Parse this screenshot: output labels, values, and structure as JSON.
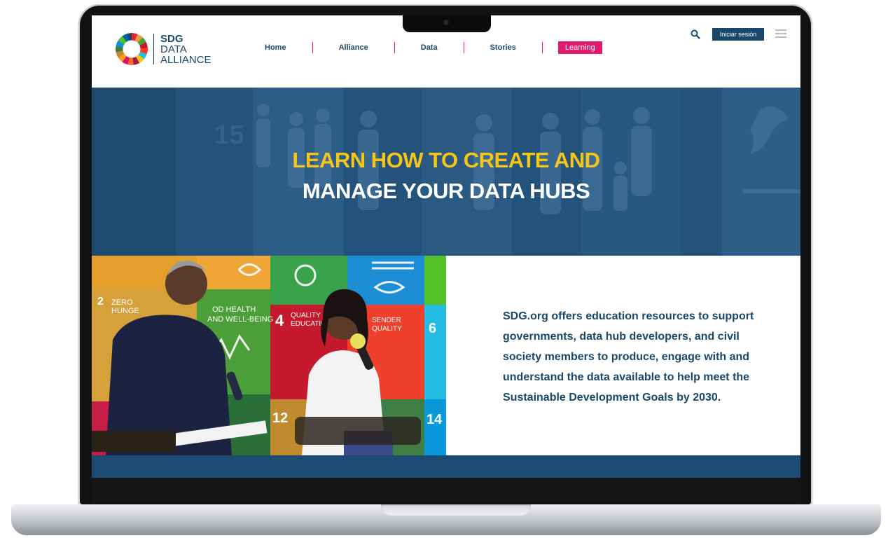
{
  "logo": {
    "line1": "SDG",
    "line2": "DATA",
    "line3": "ALLIANCE"
  },
  "nav": {
    "items": [
      {
        "label": "Home"
      },
      {
        "label": "Alliance"
      },
      {
        "label": "Data"
      },
      {
        "label": "Stories"
      },
      {
        "label": "Learning",
        "active": true
      }
    ]
  },
  "header": {
    "login_label": "Iniciar sesión",
    "search_icon": "search-icon",
    "menu_icon": "hamburger-menu-icon"
  },
  "hero": {
    "title_line1": "LEARN HOW TO CREATE AND",
    "title_line2": "MANAGE YOUR DATA HUBS"
  },
  "photo_tiles": {
    "zero": "ZERO",
    "hunger": "HUNGE",
    "good_health": "OD HEALTH",
    "well_being": "AND WELL-BEING",
    "quality": "QUALITY",
    "education": "EDUCATIO",
    "gender": "SENDER",
    "equality": "QUALITY",
    "n2": "2",
    "n4": "4",
    "n6": "6",
    "n12": "12",
    "n14": "14"
  },
  "intro": {
    "text": "SDG.org offers education resources to support governments, data hub developers, and civil society members to produce, engage with and understand the data available to help meet the Sustainable Development Goals by 2030."
  },
  "colors": {
    "navy": "#19486a",
    "hero_blue": "#23527a",
    "yellow": "#f5c518",
    "pink": "#e3196d"
  }
}
